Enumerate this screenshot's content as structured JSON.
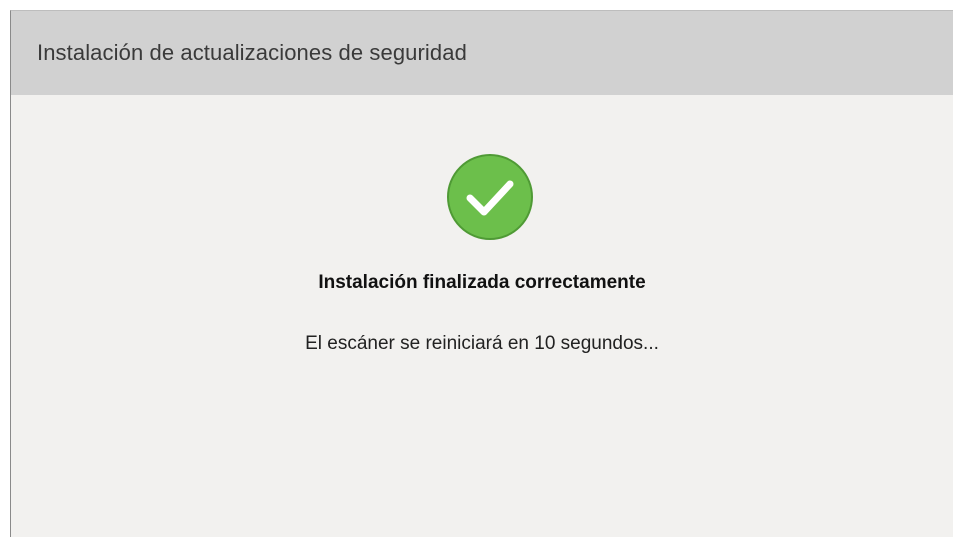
{
  "window": {
    "title": "Instalación de actualizaciones de seguridad"
  },
  "status": {
    "icon": "checkmark-circle-icon",
    "icon_color": "#6cbf4b",
    "icon_border_color": "#4f9a35",
    "heading": "Instalación finalizada correctamente",
    "message": "El escáner se reiniciará en 10 segundos..."
  },
  "colors": {
    "title_bar_bg": "#d1d1d1",
    "content_bg": "#f2f1ef"
  }
}
